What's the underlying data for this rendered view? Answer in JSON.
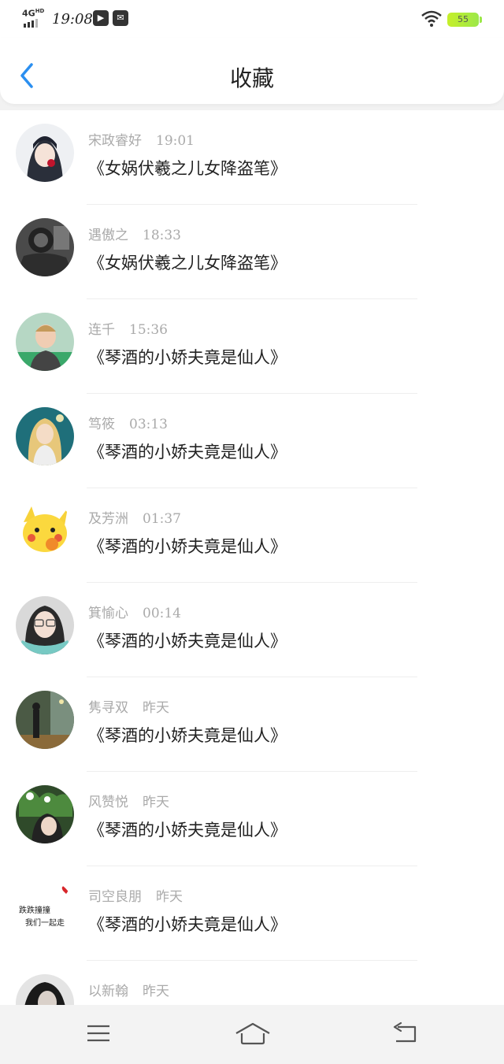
{
  "status_bar": {
    "network": "4G",
    "network_sup": "HD",
    "time": "19:08",
    "battery": "55",
    "battery_color": "#c6ef2a"
  },
  "header": {
    "title": "收藏",
    "back_icon": "chevron-left-icon",
    "accent_color": "#2b8ff0"
  },
  "favorites": [
    {
      "name": "宋政睿好",
      "time": "19:01",
      "book": "《女娲伏羲之儿女降盗笔》"
    },
    {
      "name": "遇傲之",
      "time": "18:33",
      "book": "《女娲伏羲之儿女降盗笔》"
    },
    {
      "name": "连千",
      "time": "15:36",
      "book": "《琴酒的小娇夫竟是仙人》"
    },
    {
      "name": "笃筱",
      "time": "03:13",
      "book": "《琴酒的小娇夫竟是仙人》"
    },
    {
      "name": "及芳洲",
      "time": "01:37",
      "book": "《琴酒的小娇夫竟是仙人》"
    },
    {
      "name": "箕愉心",
      "time": "00:14",
      "book": "《琴酒的小娇夫竟是仙人》"
    },
    {
      "name": "隽寻双",
      "time": "昨天",
      "book": "《琴酒的小娇夫竟是仙人》"
    },
    {
      "name": "风赞悦",
      "time": "昨天",
      "book": "《琴酒的小娇夫竟是仙人》"
    },
    {
      "name": "司空良朋",
      "time": "昨天",
      "book": "《琴酒的小娇夫竟是仙人》"
    },
    {
      "name": "以新翰",
      "time": "昨天",
      "book": ""
    }
  ],
  "avatar_text": {
    "line1": "跌跌撞撞",
    "line2": "我们一起走"
  },
  "nav_bar": {
    "menu_icon": "menu-icon",
    "home_icon": "home-icon",
    "back_icon": "return-icon"
  }
}
